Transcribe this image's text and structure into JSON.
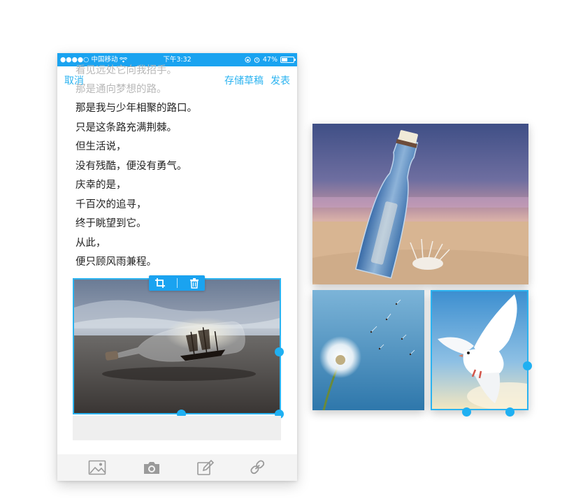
{
  "status_bar": {
    "carrier": "●●●●○ 中国移动",
    "time": "下午3:32",
    "battery": "47%",
    "battery_level": 0.47
  },
  "nav": {
    "cancel": "取消",
    "save_draft": "存储草稿",
    "publish": "发表"
  },
  "faded_lines": [
    "看见远处它向我招手。",
    "那是通向梦想的路。"
  ],
  "poem": [
    "那是我与少年相聚的路口。",
    "只是这条路充满荆棘。",
    "但生活说，",
    "没有残酷，便没有勇气。",
    "庆幸的是，",
    "千百次的追寻，",
    "终于眺望到它。",
    "从此，",
    "便只顾风雨兼程。"
  ],
  "image_toolbar": {
    "crop_icon": "crop-icon",
    "delete_icon": "trash-icon"
  },
  "bottom_toolbar": {
    "icons": [
      "image-icon",
      "camera-icon",
      "edit-icon",
      "link-icon"
    ]
  },
  "colors": {
    "accent": "#1aa3f0",
    "link": "#2bb3f0",
    "text": "#222222",
    "faded": "#b8b8b8"
  }
}
